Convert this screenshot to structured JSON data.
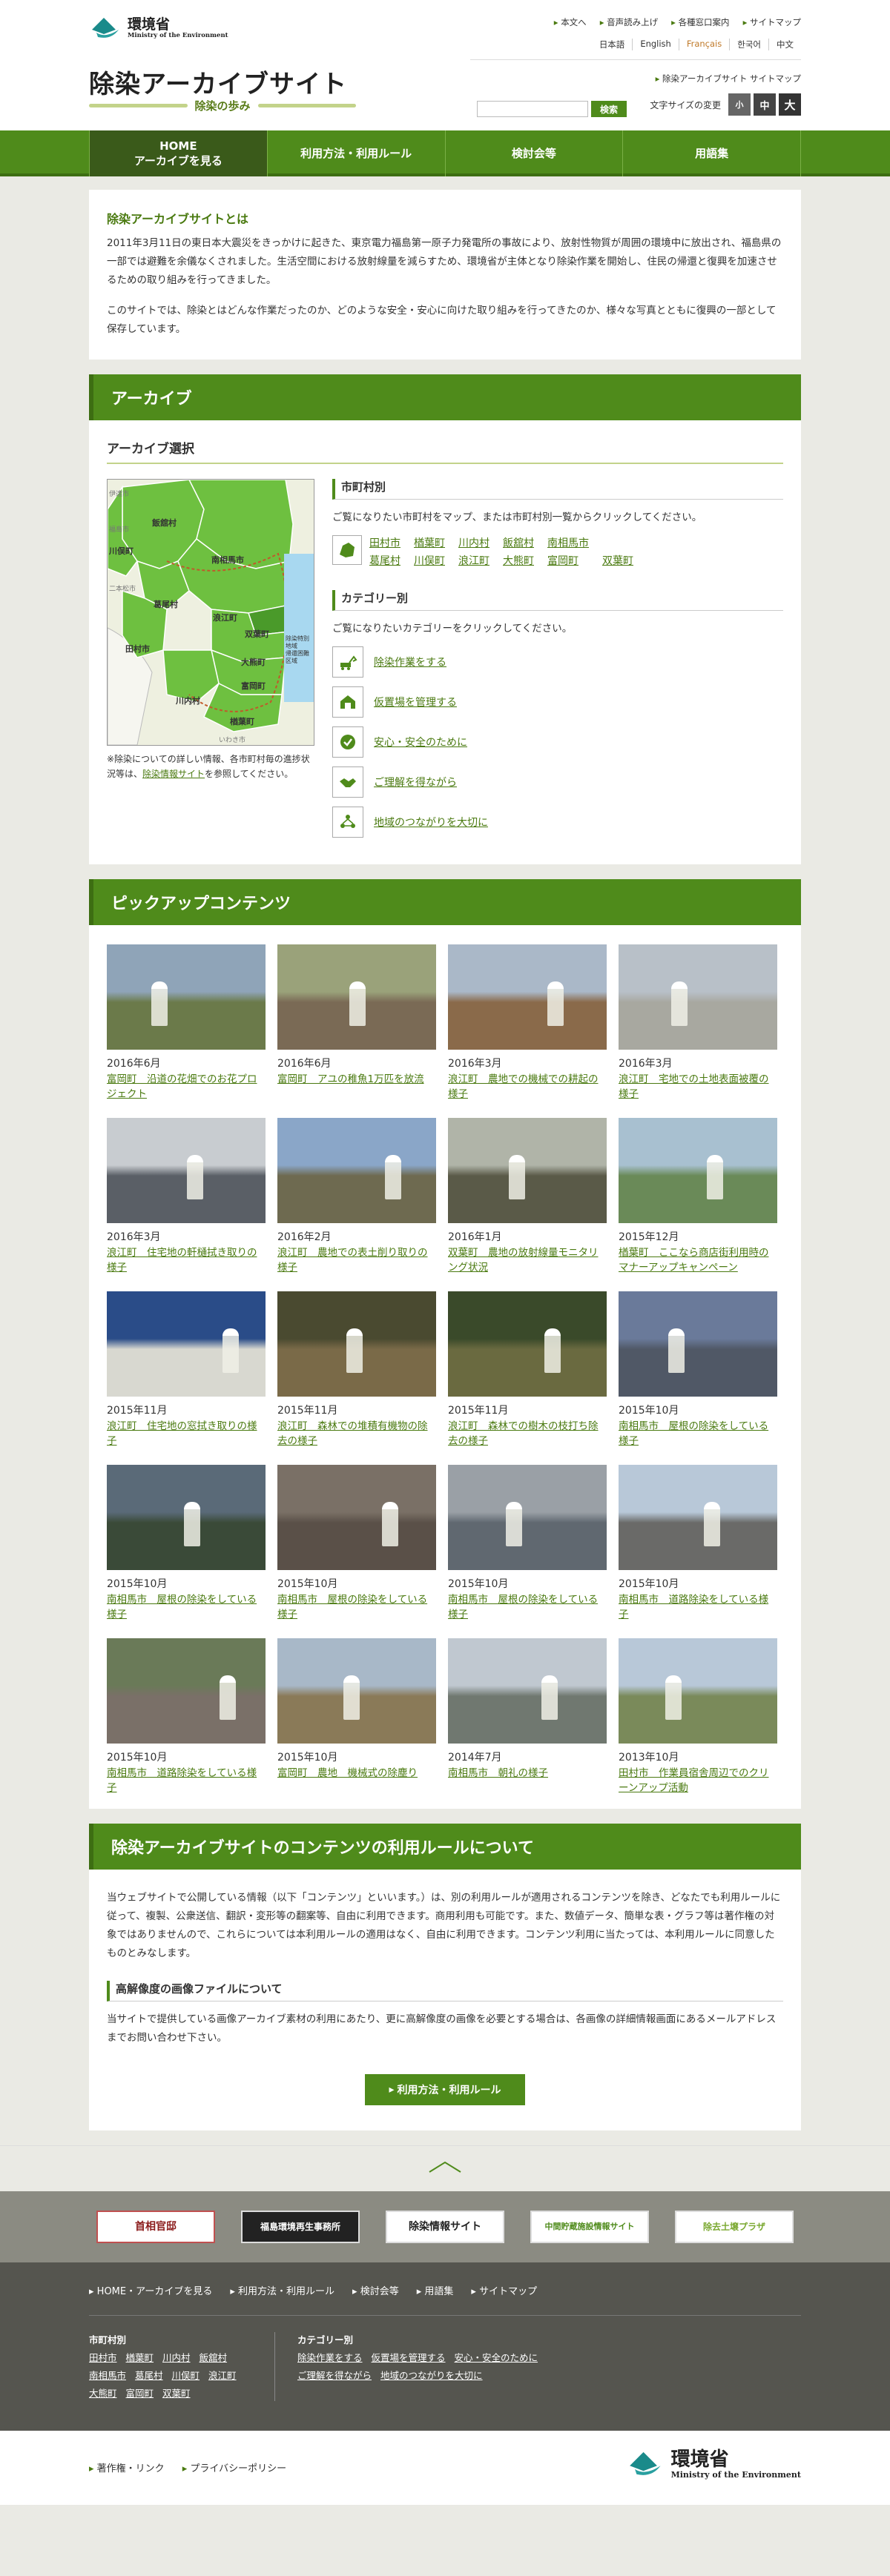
{
  "header": {
    "logo_jp": "環境省",
    "logo_en": "Ministry of the Environment",
    "site_title": "除染アーカイブサイト",
    "site_subtitle": "除染の歩み",
    "util_links": [
      "本文へ",
      "音声読み上げ",
      "各種窓口案内",
      "サイトマップ"
    ],
    "languages": [
      "日本語",
      "English",
      "Français",
      "한국어",
      "中文"
    ],
    "sitemap_link": "除染アーカイブサイト サイトマップ",
    "search_button": "検索",
    "search_placeholder": "",
    "font_size_label": "文字サイズの変更",
    "font_sizes": [
      "小",
      "中",
      "大"
    ]
  },
  "gnav": [
    {
      "label": "HOME\nアーカイブを見る",
      "line1": "HOME",
      "line2": "アーカイブを見る"
    },
    {
      "label": "利用方法・利用ルール"
    },
    {
      "label": "検討会等"
    },
    {
      "label": "用語集"
    }
  ],
  "intro": {
    "title": "除染アーカイブサイトとは",
    "p1": "2011年3月11日の東日本大震災をきっかけに起きた、東京電力福島第一原子力発電所の事故により、放射性物質が周囲の環境中に放出され、福島県の一部では避難を余儀なくされました。生活空間における放射線量を減らすため、環境省が主体となり除染作業を開始し、住民の帰還と復興を加速させるための取り組みを行ってきました。",
    "p2": "このサイトでは、除染とはどんな作業だったのか、どのような安全・安心に向けた取り組みを行ってきたのか、様々な写真とともに復興の一部として保存しています。"
  },
  "archive": {
    "heading": "アーカイブ",
    "select_title": "アーカイブ選択",
    "map_labels": [
      "飯舘村",
      "川俣町",
      "南相馬市",
      "葛尾村",
      "浪江町",
      "田村市",
      "双葉町",
      "大熊町",
      "富岡町",
      "川内村",
      "楢葉町",
      "伊達市",
      "福島市",
      "いわき市",
      "二本松市"
    ],
    "map_legend": [
      "除染特別地域",
      "帰還困難区域"
    ],
    "map_note_pre": "※除染についての詳しい情報、各市町村毎の進捗状況等は、",
    "map_note_link": "除染情報サイト",
    "map_note_post": "を参照してください。",
    "muni_title": "市町村別",
    "muni_desc": "ご覧になりたい市町村をマップ、または市町村別一覧からクリックしてください。",
    "municipalities": [
      "田村市",
      "楢葉町",
      "川内村",
      "飯舘村",
      "南相馬市",
      "葛尾村",
      "川俣町",
      "浪江町",
      "大熊町",
      "富岡町",
      "双葉町"
    ],
    "cat_title": "カテゴリー別",
    "cat_desc": "ご覧になりたいカテゴリーをクリックしてください。",
    "categories": [
      "除染作業をする",
      "仮置場を管理する",
      "安心・安全のために",
      "ご理解を得ながら",
      "地域のつながりを大切に"
    ]
  },
  "pickup": {
    "heading": "ピックアップコンテンツ",
    "items": [
      {
        "date": "2016年6月",
        "title": "富岡町　沿道の花畑でのお花プロジェクト",
        "c1": "#8fa4b8",
        "c2": "#6b7a4a"
      },
      {
        "date": "2016年6月",
        "title": "富岡町　アユの稚魚1万匹を放流",
        "c1": "#9aa27a",
        "c2": "#7a6a55"
      },
      {
        "date": "2016年3月",
        "title": "浪江町　農地での機械での耕起の様子",
        "c1": "#aab8c8",
        "c2": "#8a6a4a"
      },
      {
        "date": "2016年3月",
        "title": "浪江町　宅地での土地表面被覆の様子",
        "c1": "#b8c0c8",
        "c2": "#a8a8a0"
      },
      {
        "date": "2016年3月",
        "title": "浪江町　住宅地の軒樋拭き取りの様子",
        "c1": "#c8ccd0",
        "c2": "#5a5f66"
      },
      {
        "date": "2016年2月",
        "title": "浪江町　農地での表土削り取りの様子",
        "c1": "#8aa6c8",
        "c2": "#6e6a50"
      },
      {
        "date": "2016年1月",
        "title": "双葉町　農地の放射線量モニタリング状況",
        "c1": "#b0b4a8",
        "c2": "#5a5a48"
      },
      {
        "date": "2015年12月",
        "title": "楢葉町　ここなら商店街利用時のマナーアップキャンペーン",
        "c1": "#a8c0d0",
        "c2": "#6a8a58"
      },
      {
        "date": "2015年11月",
        "title": "浪江町　住宅地の窓拭き取りの様子",
        "c1": "#2a4c88",
        "c2": "#d8d8d0"
      },
      {
        "date": "2015年11月",
        "title": "浪江町　森林での堆積有機物の除去の様子",
        "c1": "#4a4a30",
        "c2": "#7a6a48"
      },
      {
        "date": "2015年11月",
        "title": "浪江町　森林での樹木の枝打ち除去の様子",
        "c1": "#3a4a2a",
        "c2": "#6a6a40"
      },
      {
        "date": "2015年10月",
        "title": "南相馬市　屋根の除染をしている様子",
        "c1": "#6a7a9a",
        "c2": "#505866"
      },
      {
        "date": "2015年10月",
        "title": "南相馬市　屋根の除染をしている様子",
        "c1": "#5a6a78",
        "c2": "#3a4a38"
      },
      {
        "date": "2015年10月",
        "title": "南相馬市　屋根の除染をしている様子",
        "c1": "#7a7066",
        "c2": "#5a5048"
      },
      {
        "date": "2015年10月",
        "title": "南相馬市　屋根の除染をしている様子",
        "c1": "#9aa0a6",
        "c2": "#606870"
      },
      {
        "date": "2015年10月",
        "title": "南相馬市　道路除染をしている様子",
        "c1": "#b8c8d8",
        "c2": "#6a6a68"
      },
      {
        "date": "2015年10月",
        "title": "南相馬市　道路除染をしている様子",
        "c1": "#6a7a58",
        "c2": "#7a7068"
      },
      {
        "date": "2015年10月",
        "title": "富岡町　農地　機械式の除塵り",
        "c1": "#a8b8c8",
        "c2": "#8a7a58"
      },
      {
        "date": "2014年7月",
        "title": "南相馬市　朝礼の様子",
        "c1": "#c0c8d0",
        "c2": "#707870"
      },
      {
        "date": "2013年10月",
        "title": "田村市　作業員宿舎周辺でのクリーンアップ活動",
        "c1": "#b8c8d8",
        "c2": "#7a8a5a"
      }
    ]
  },
  "rules": {
    "heading": "除染アーカイブサイトのコンテンツの利用ルールについて",
    "p1": "当ウェブサイトで公開している情報（以下「コンテンツ」といいます。）は、別の利用ルールが適用されるコンテンツを除き、どなたでも利用ルールに従って、複製、公衆送信、翻訳・変形等の翻案等、自由に利用できます。商用利用も可能です。また、数値データ、簡単な表・グラフ等は著作権の対象ではありませんので、これらについては本利用ルールの適用はなく、自由に利用できます。コンテンツ利用に当たっては、本利用ルールに同意したものとみなします。",
    "subhead": "高解像度の画像ファイルについて",
    "p2": "当サイトで提供している画像アーカイブ素材の利用にあたり、更に高解像度の画像を必要とする場合は、各画像の詳細情報画面にあるメールアドレスまでお問い合わせ下さい。",
    "button": "利用方法・利用ルール"
  },
  "banners": [
    {
      "label": "首相官邸"
    },
    {
      "label": "福島環境再生事務所"
    },
    {
      "label": "除染情報サイト"
    },
    {
      "label": "中間貯蔵施設情報サイト"
    },
    {
      "label": "除去土壌プラザ"
    }
  ],
  "footer": {
    "links": [
      "HOME・アーカイブを見る",
      "利用方法・利用ルール",
      "検討会等",
      "用語集",
      "サイトマップ"
    ],
    "muni_title": "市町村別",
    "muni_links": [
      "田村市",
      "楢葉町",
      "川内村",
      "飯舘村",
      "南相馬市",
      "葛尾村",
      "川俣町",
      "浪江町",
      "大熊町",
      "富岡町",
      "双葉町"
    ],
    "cat_title": "カテゴリー別",
    "cat_links": [
      "除染作業をする",
      "仮置場を管理する",
      "安心・安全のために",
      "ご理解を得ながら",
      "地域のつながりを大切に"
    ],
    "bottom_links": [
      "著作権・リンク",
      "プライバシーポリシー"
    ],
    "logo_jp": "環境省",
    "logo_en": "Ministry of the Environment"
  },
  "colors": {
    "brand_green": "#4f8b1b",
    "dark_green": "#3a5a1a",
    "map_green": "#6ec040",
    "map_light": "#e0eab8"
  },
  "icons": [
    "moe-logo-icon",
    "map-icon",
    "excavator-icon",
    "storage-icon",
    "safety-icon",
    "handshake-icon",
    "community-icon",
    "pagetop-arrow-icon"
  ]
}
